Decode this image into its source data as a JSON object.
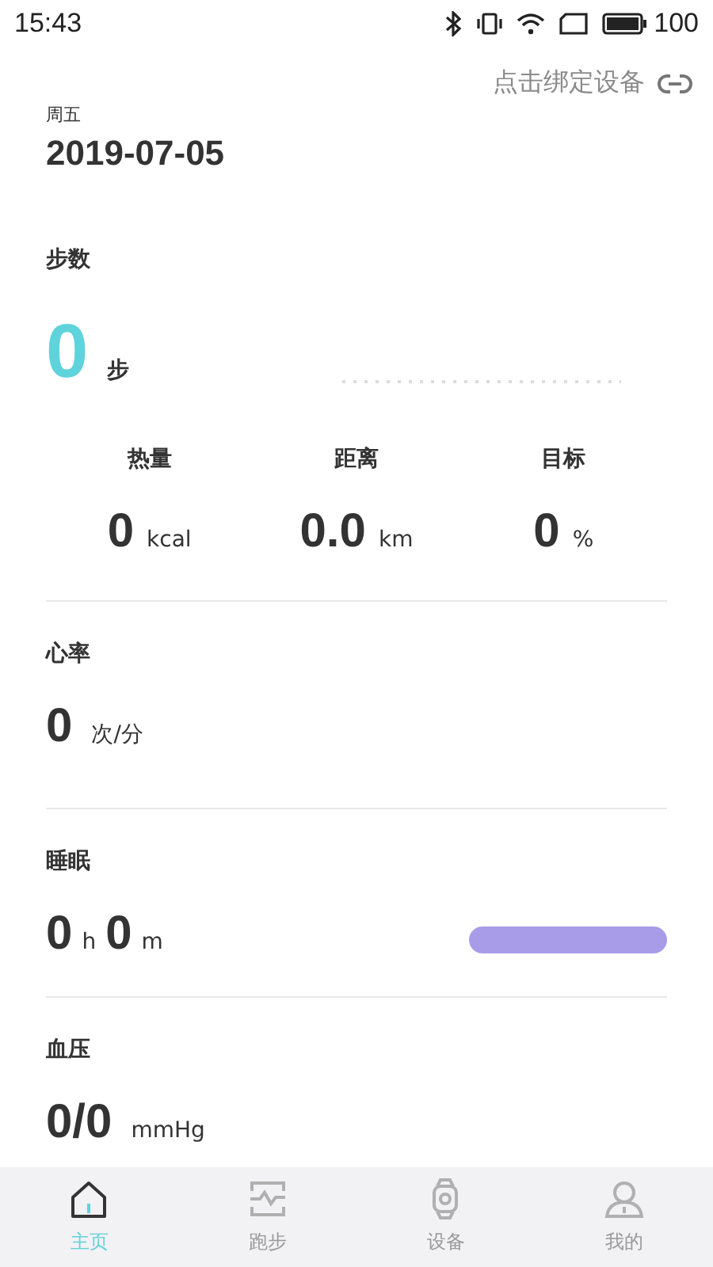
{
  "status_bar": {
    "time": "15:43",
    "battery": "100"
  },
  "bind_link": "点击绑定设备",
  "day": "周五",
  "date": "2019-07-05",
  "steps": {
    "title": "步数",
    "value": "0",
    "unit": "步",
    "stats": [
      {
        "label": "热量",
        "value": "0",
        "unit": "kcal"
      },
      {
        "label": "距离",
        "value": "0.0",
        "unit": "km"
      },
      {
        "label": "目标",
        "value": "0",
        "unit": "%"
      }
    ]
  },
  "heart_rate": {
    "title": "心率",
    "value": "0",
    "unit": "次/分"
  },
  "sleep": {
    "title": "睡眠",
    "hours": "0",
    "hours_unit": "h",
    "minutes": "0",
    "minutes_unit": "m"
  },
  "blood_pressure": {
    "title": "血压",
    "value": "0/0",
    "unit": "mmHg"
  },
  "tabs": [
    {
      "label": "主页",
      "selected": true
    },
    {
      "label": "跑步",
      "selected": false
    },
    {
      "label": "设备",
      "selected": false
    },
    {
      "label": "我的",
      "selected": false
    }
  ]
}
